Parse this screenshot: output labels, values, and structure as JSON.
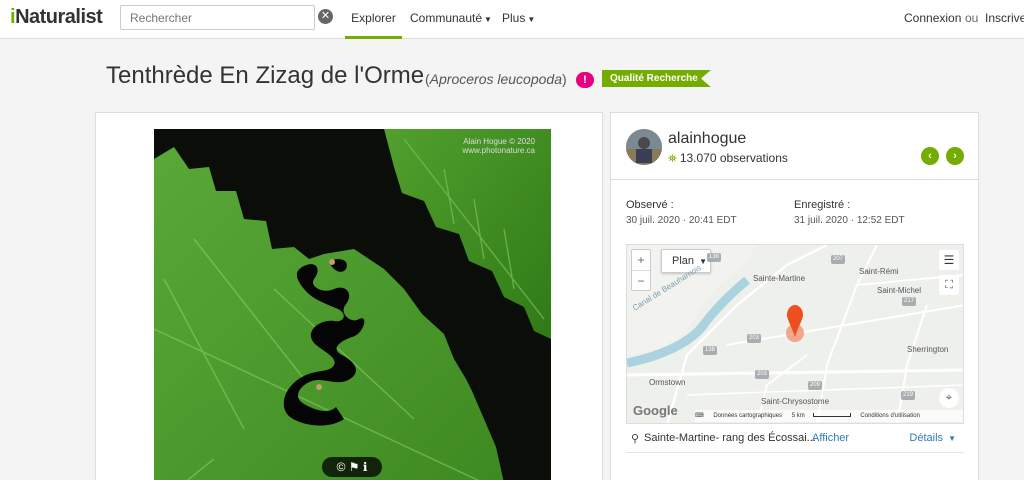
{
  "header": {
    "logo_prefix": "i",
    "logo_rest": "Naturalist",
    "search_placeholder": "Rechercher",
    "nav": {
      "explore": "Explorer",
      "community": "Communauté",
      "more": "Plus"
    },
    "login": "Connexion",
    "or": "ou",
    "signup": "Inscrivez-vous"
  },
  "observation": {
    "common_name": "Tenthrède En Zizag de l'Orme",
    "scientific_name": "Aproceros leucopoda",
    "alert_glyph": "!",
    "quality_badge": "Qualité Recherche",
    "photo_credit_line1": "Alain Hogue © 2020",
    "photo_credit_line2": "www.photonature.ca",
    "photo_icons": "© ⚑ ℹ"
  },
  "user": {
    "username": "alainhogue",
    "observations_count": "13.070 observations",
    "prev_glyph": "‹",
    "next_glyph": "›"
  },
  "dates": {
    "observed_label": "Observé :",
    "observed_value": "30 juil. 2020 · 20:41 EDT",
    "submitted_label": "Enregistré :",
    "submitted_value": "31 juil. 2020 · 12:52 EDT"
  },
  "map": {
    "zoom_in": "+",
    "zoom_out": "−",
    "map_type": "Plan",
    "towns": {
      "sainte_martine": "Sainte-Martine",
      "saint_remi": "Saint-Rémi",
      "saint_michel": "Saint-Michel",
      "sherrington": "Sherrington",
      "ormstown": "Ormstown",
      "sainte_chrysostome": "Saint-Chrysostome",
      "canal": "Canal de Beauharnois"
    },
    "highways": {
      "h138a": "138",
      "h207": "207",
      "h138b": "138",
      "h203a": "203",
      "h203b": "203",
      "h209": "209",
      "h217": "217",
      "h219": "219"
    },
    "google": "Google",
    "data_label": "Données cartographiques",
    "scale": "5 km",
    "terms": "Conditions d'utilisation"
  },
  "location": {
    "text": "Sainte-Martine- rang des Écossai...",
    "show": "Afficher",
    "details": "Détails"
  },
  "colors": {
    "accent": "#74ac00",
    "alert": "#e6007e",
    "link": "#337ab7",
    "marker": "#f0612b"
  }
}
